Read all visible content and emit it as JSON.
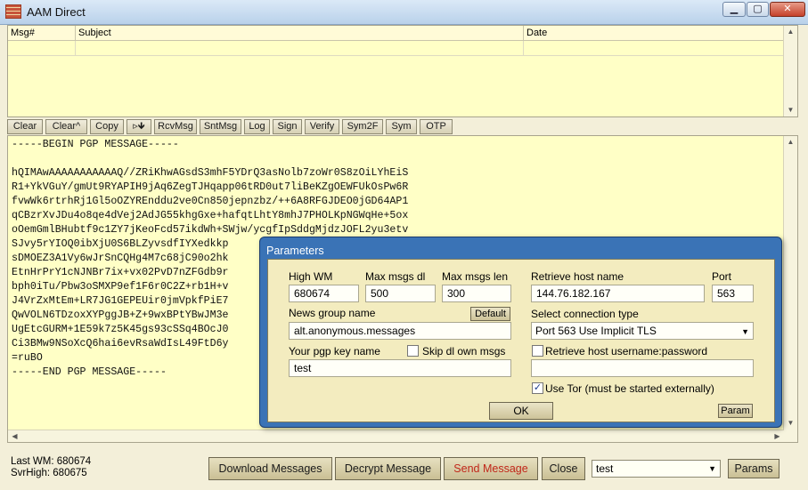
{
  "window": {
    "title": "AAM Direct"
  },
  "msglist": {
    "columns": [
      "Msg#",
      "Subject",
      "Date"
    ]
  },
  "toolbar": {
    "buttons": [
      "Clear",
      "Clear^",
      "Copy",
      "▹🡻",
      "RcvMsg",
      "SntMsg",
      "Log",
      "Sign",
      "Verify",
      "Sym2F",
      "Sym",
      "OTP"
    ]
  },
  "editor": {
    "text": "-----BEGIN PGP MESSAGE-----\n\nhQIMAwAAAAAAAAAAAQ//ZRiKhwAGsdS3mhF5YDrQ3asNolb7zoWr0S8zOiLYhEiS\nR1+YkVGuY/gmUt9RYAPIH9jAq6ZegTJHqapp06tRD0ut7liBeKZgOEWFUkOsPw6R\nfvwWk6rtrhRj1Gl5oOZYREnddu2ve0Cn850jepnzbz/++6A8RFGJDEO0jGD64AP1\nqCBzrXvJDu4o8qe4dVej2AdJG55khgGxe+hafqtLhtY8mhJ7PHOLKpNGWqHe+5ox\noOemGmlBHubtf9c1ZY7jKeoFcd57ikdWh+SWjw/ycgfIpSddgMjdzJOFL2yu3etv\nSJvy5rYIOQ0ibXjU0S6BLZyvsdfIYXedkkp\nsDMOEZ3A1Vy6wJrSnCQHg4M7c68jC90o2hk\nEtnHrPrY1cNJNBr7ix+vx02PvD7nZFGdb9r\nbph0iTu/Pbw3oSMXP9ef1F6r0C2Z+rb1H+v\nJ4VrZxMtEm+LR7JG1GEPEUir0jmVpkfPiE7\nQwVOLN6TDzoxXYPggJB+Z+9wxBPtYBwJM3e\nUgEtcGURM+1E59k7z5K45gs93cSSq4BOcJ0\nCi3BMw9NSoXcQ6hai6evRsaWdIsL49FtD6y\n=ruBO\n-----END PGP MESSAGE-----"
  },
  "status": {
    "last_wm": "Last WM: 680674",
    "svr_high": "SvrHigh: 680675"
  },
  "bottom": {
    "download_label": "Download Messages",
    "decrypt_label": "Decrypt Message",
    "send_label": "Send Message",
    "close_label": "Close",
    "profile_value": "test",
    "params_label": "Params",
    "send_color": "#c1271a"
  },
  "params": {
    "title": "Parameters",
    "high_wm_label": "High WM",
    "high_wm_value": "680674",
    "max_msgs_dl_label": "Max msgs dl",
    "max_msgs_dl_value": "500",
    "max_msgs_len_label": "Max msgs len",
    "max_msgs_len_value": "300",
    "retrieve_host_label": "Retrieve host name",
    "retrieve_host_value": "144.76.182.167",
    "port_label": "Port",
    "port_value": "563",
    "news_group_label": "News group name",
    "default_label": "Default",
    "news_group_value": "alt.anonymous.messages",
    "conn_type_label": "Select connection type",
    "conn_type_value": "Port 563 Use Implicit TLS",
    "pgp_key_label": "Your pgp key name",
    "skip_dl_label": "Skip dl own msgs",
    "skip_dl_checked": false,
    "pgp_key_value": "test",
    "retrieve_userpass_label": "Retrieve host username:password",
    "retrieve_userpass_checked": false,
    "retrieve_userpass_value": "",
    "use_tor_label": "Use Tor (must be started externally)",
    "use_tor_checked": true,
    "ok_label": "OK",
    "param_label": "Param"
  }
}
